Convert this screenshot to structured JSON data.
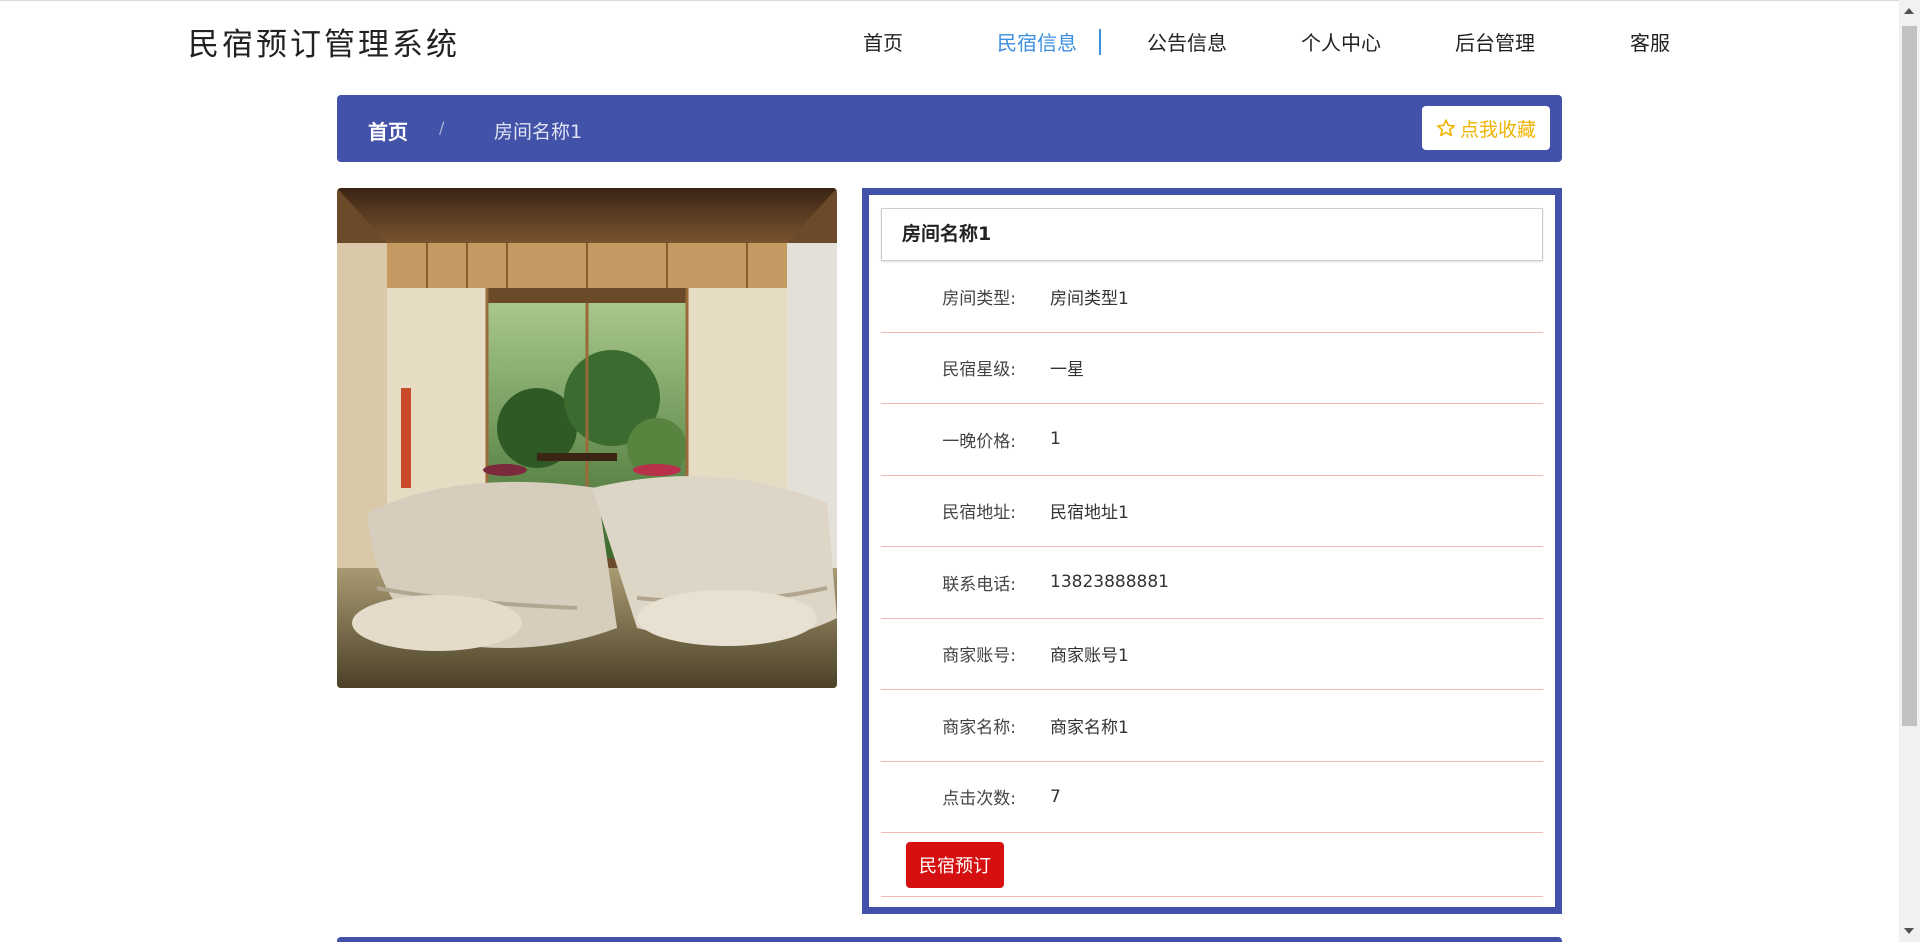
{
  "header": {
    "logo": "民宿预订管理系统",
    "nav": [
      {
        "label": "首页"
      },
      {
        "label": "民宿信息",
        "active": true
      },
      {
        "label": "公告信息"
      },
      {
        "label": "个人中心"
      },
      {
        "label": "后台管理"
      },
      {
        "label": "客服"
      }
    ]
  },
  "breadcrumb": {
    "home": "首页",
    "separator": "/",
    "current": "房间名称1",
    "favorite_label": "点我收藏",
    "favorite_icon": "star-outline-icon"
  },
  "detail": {
    "title": "房间名称1",
    "fields": [
      {
        "label": "房间类型:",
        "value": "房间类型1"
      },
      {
        "label": "民宿星级:",
        "value": "一星"
      },
      {
        "label": "一晚价格:",
        "value": "1"
      },
      {
        "label": "民宿地址:",
        "value": "民宿地址1"
      },
      {
        "label": "联系电话:",
        "value": "13823888881"
      },
      {
        "label": "商家账号:",
        "value": "商家账号1"
      },
      {
        "label": "商家名称:",
        "value": "商家名称1"
      },
      {
        "label": "点击次数:",
        "value": "7"
      }
    ],
    "book_label": "民宿预订"
  },
  "colors": {
    "primary": "#4252a8",
    "nav_active": "#3d8fe0",
    "favorite": "#f0b400",
    "book_button": "#d61010",
    "row_divider": "#f4b8b8"
  }
}
